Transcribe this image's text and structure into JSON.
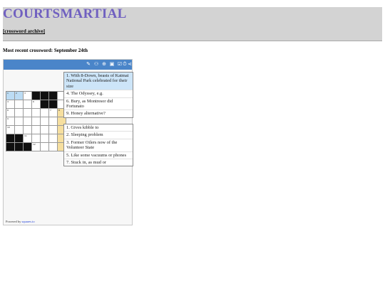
{
  "site": {
    "title": "COURTSMARTIAL",
    "archive_link": "[crossword archive]"
  },
  "recent_heading": "Most recent crossword: September 24th",
  "toolbar": {
    "icons": [
      "pencil-icon",
      "people-icon",
      "life-ring-icon",
      "info-icon",
      "check-icon",
      "timer-icon",
      "share-icon"
    ],
    "glyphs": [
      "✎",
      "⚇",
      "⊕",
      "▣",
      "☑",
      "⏱",
      "⋖"
    ]
  },
  "grid": {
    "rows": 7,
    "cols": 7,
    "cells": [
      [
        "sel",
        "sel",
        "",
        "black",
        "black",
        "black",
        ""
      ],
      [
        "",
        "",
        "",
        "",
        "black",
        "black",
        ""
      ],
      [
        "",
        "",
        "",
        "",
        "",
        "",
        "word"
      ],
      [
        "",
        "",
        "",
        "",
        "",
        "",
        "word"
      ],
      [
        "",
        "",
        "",
        "",
        "",
        "",
        "word"
      ],
      [
        "black",
        "black",
        "",
        "",
        "",
        "",
        "word"
      ],
      [
        "black",
        "black",
        "black",
        "",
        "",
        "",
        "word"
      ]
    ],
    "numbers": [
      {
        "r": 0,
        "c": 0,
        "n": "1"
      },
      {
        "r": 0,
        "c": 1,
        "n": "2"
      },
      {
        "r": 0,
        "c": 2,
        "n": "3"
      },
      {
        "r": 1,
        "c": 0,
        "n": "4"
      },
      {
        "r": 1,
        "c": 3,
        "n": "6"
      },
      {
        "r": 2,
        "c": 0,
        "n": "8"
      },
      {
        "r": 2,
        "c": 5,
        "n": "7"
      },
      {
        "r": 2,
        "c": 6,
        "n": "8"
      },
      {
        "r": 3,
        "c": 0,
        "n": "9"
      },
      {
        "r": 4,
        "c": 0,
        "n": "10"
      },
      {
        "r": 5,
        "c": 2,
        "n": "11"
      },
      {
        "r": 6,
        "c": 3,
        "n": "12"
      }
    ]
  },
  "across_clues": [
    "1. With 8-Down, beasts of Katmai National Park celebrated for their size",
    "4. The Odyssey, e.g.",
    "6. Bury, as Montresor did Fortunato",
    "9. Honey alternative?"
  ],
  "down_clues": [
    "1. Gives kibble to",
    "2. Sleeping problem",
    "3. Former Oilers now of the Volunteer State",
    "5. Like some vacuums or phones",
    "7. Stuck in, as mud or"
  ],
  "powered": {
    "prefix": "Powered by ",
    "link": "squares.io"
  },
  "colors": {
    "title": "#7060c0",
    "toolbar": "#4a85c9",
    "selected_cell": "#bcdcf4",
    "word_cell": "#f6df9f"
  }
}
